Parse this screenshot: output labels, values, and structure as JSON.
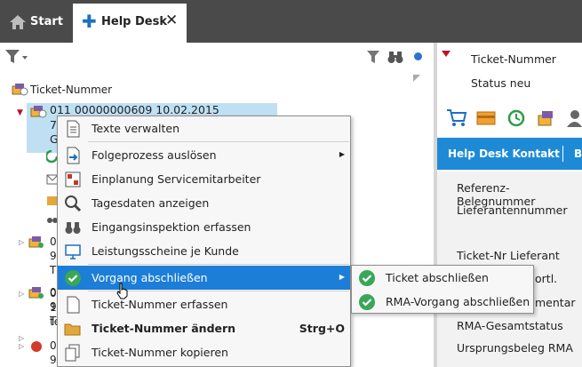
{
  "tabs": {
    "start_label": "Start",
    "help_desk_label": "Help Desk"
  },
  "tree": {
    "root_label": "Ticket-Nummer",
    "selected": {
      "line1": "011 00000000609 10.02.2015",
      "line2": "7",
      "line3": "G"
    },
    "collapsed_items": [
      {
        "line1": "0",
        "line2": "9",
        "line3": "T"
      },
      {
        "line1": "0",
        "line2": "9",
        "line3": "T"
      },
      {
        "line1": "0",
        "line2": "1",
        "line3": "te"
      },
      {
        "line1": "0",
        "line2": "9"
      }
    ]
  },
  "right_pane": {
    "header_rows": [
      "Ticket-Nummer",
      "Status neu"
    ],
    "tab_active": "Help Desk Kontakt",
    "tab_next": "B",
    "fields": [
      "Referenz-Belegnummer",
      "Lieferantennummer",
      "Ticket-Nr Lieferant",
      "ortl.",
      "mentar",
      "RMA-Gesamtstatus",
      "Ursprungsbeleg RMA"
    ]
  },
  "context_menu": {
    "items": [
      {
        "label": "Texte verwalten"
      },
      {
        "label": "Folgeprozess auslösen"
      },
      {
        "label": "Einplanung Servicemitarbeiter"
      },
      {
        "label": "Tagesdaten anzeigen"
      },
      {
        "label": "Eingangsinspektion erfassen"
      },
      {
        "label": "Leistungsscheine je Kunde"
      },
      {
        "label": "Vorgang abschließen"
      },
      {
        "label": "Ticket-Nummer erfassen"
      },
      {
        "label": "Ticket-Nummer ändern",
        "shortcut": "Strg+O"
      },
      {
        "label": "Ticket-Nummer kopieren"
      }
    ]
  },
  "submenu": {
    "items": [
      {
        "label": "Ticket abschließen"
      },
      {
        "label": "RMA-Vorgang abschließen"
      }
    ]
  },
  "colors": {
    "tabbar": "#4a4a4a",
    "accent": "#1e8ad6",
    "highlight": "#1c7ed6",
    "selection": "#bfe0f3",
    "check_green": "#3aa657"
  }
}
